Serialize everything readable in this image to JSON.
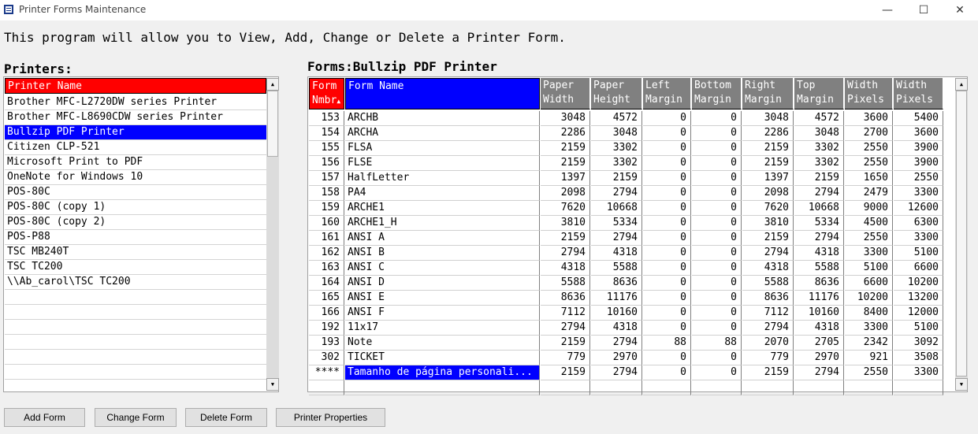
{
  "window": {
    "title": "Printer Forms Maintenance",
    "minimize": "—",
    "maximize": "☐",
    "close": "✕"
  },
  "intro": "This program will allow you to View, Add, Change or Delete a Printer Form.",
  "printers": {
    "title": "Printers:",
    "column_header": "Printer Name",
    "selected_index": 2,
    "items": [
      "Brother MFC-L2720DW series Printer",
      "Brother MFC-L8690CDW series Printer",
      "Bullzip PDF Printer",
      "Citizen CLP-521",
      "Microsoft Print to PDF",
      "OneNote for Windows 10",
      "POS-80C",
      "POS-80C (copy 1)",
      "POS-80C (copy 2)",
      "POS-P88",
      "TSC MB240T",
      "TSC TC200",
      "\\\\Ab_carol\\TSC TC200"
    ]
  },
  "forms": {
    "title": "Forms:Bullzip PDF Printer",
    "sort_indicator": "▲",
    "columns": [
      {
        "line1": "Form",
        "line2": "Nmbr"
      },
      {
        "line1": "Form Name",
        "line2": ""
      },
      {
        "line1": "Paper",
        "line2": "Width"
      },
      {
        "line1": "Paper",
        "line2": "Height"
      },
      {
        "line1": "Left",
        "line2": "Margin"
      },
      {
        "line1": "Bottom",
        "line2": "Margin"
      },
      {
        "line1": "Right",
        "line2": "Margin"
      },
      {
        "line1": "Top",
        "line2": "Margin"
      },
      {
        "line1": "Width",
        "line2": "Pixels"
      },
      {
        "line1": "Width",
        "line2": "Pixels"
      }
    ],
    "selected_row": 17,
    "rows": [
      [
        "153",
        "ARCHB",
        "3048",
        "4572",
        "0",
        "0",
        "3048",
        "4572",
        "3600",
        "5400"
      ],
      [
        "154",
        "ARCHA",
        "2286",
        "3048",
        "0",
        "0",
        "2286",
        "3048",
        "2700",
        "3600"
      ],
      [
        "155",
        "FLSA",
        "2159",
        "3302",
        "0",
        "0",
        "2159",
        "3302",
        "2550",
        "3900"
      ],
      [
        "156",
        "FLSE",
        "2159",
        "3302",
        "0",
        "0",
        "2159",
        "3302",
        "2550",
        "3900"
      ],
      [
        "157",
        "HalfLetter",
        "1397",
        "2159",
        "0",
        "0",
        "1397",
        "2159",
        "1650",
        "2550"
      ],
      [
        "158",
        "PA4",
        "2098",
        "2794",
        "0",
        "0",
        "2098",
        "2794",
        "2479",
        "3300"
      ],
      [
        "159",
        "ARCHE1",
        "7620",
        "10668",
        "0",
        "0",
        "7620",
        "10668",
        "9000",
        "12600"
      ],
      [
        "160",
        "ARCHE1_H",
        "3810",
        "5334",
        "0",
        "0",
        "3810",
        "5334",
        "4500",
        "6300"
      ],
      [
        "161",
        "ANSI A",
        "2159",
        "2794",
        "0",
        "0",
        "2159",
        "2794",
        "2550",
        "3300"
      ],
      [
        "162",
        "ANSI B",
        "2794",
        "4318",
        "0",
        "0",
        "2794",
        "4318",
        "3300",
        "5100"
      ],
      [
        "163",
        "ANSI C",
        "4318",
        "5588",
        "0",
        "0",
        "4318",
        "5588",
        "5100",
        "6600"
      ],
      [
        "164",
        "ANSI D",
        "5588",
        "8636",
        "0",
        "0",
        "5588",
        "8636",
        "6600",
        "10200"
      ],
      [
        "165",
        "ANSI E",
        "8636",
        "11176",
        "0",
        "0",
        "8636",
        "11176",
        "10200",
        "13200"
      ],
      [
        "166",
        "ANSI F",
        "7112",
        "10160",
        "0",
        "0",
        "7112",
        "10160",
        "8400",
        "12000"
      ],
      [
        "192",
        "11x17",
        "2794",
        "4318",
        "0",
        "0",
        "2794",
        "4318",
        "3300",
        "5100"
      ],
      [
        "193",
        "Note",
        "2159",
        "2794",
        "88",
        "88",
        "2070",
        "2705",
        "2342",
        "3092"
      ],
      [
        "302",
        "TICKET",
        "779",
        "2970",
        "0",
        "0",
        "779",
        "2970",
        "921",
        "3508"
      ],
      [
        "****",
        "Tamanho de página personali...",
        "2159",
        "2794",
        "0",
        "0",
        "2159",
        "2794",
        "2550",
        "3300"
      ]
    ]
  },
  "buttons": {
    "add": "Add Form",
    "change": "Change Form",
    "delete": "Delete Form",
    "properties": "Printer Properties"
  },
  "colors": {
    "header_red": "#ff0000",
    "header_blue": "#0000ff",
    "selection_blue": "#0000ff",
    "header_gray": "#808080"
  }
}
